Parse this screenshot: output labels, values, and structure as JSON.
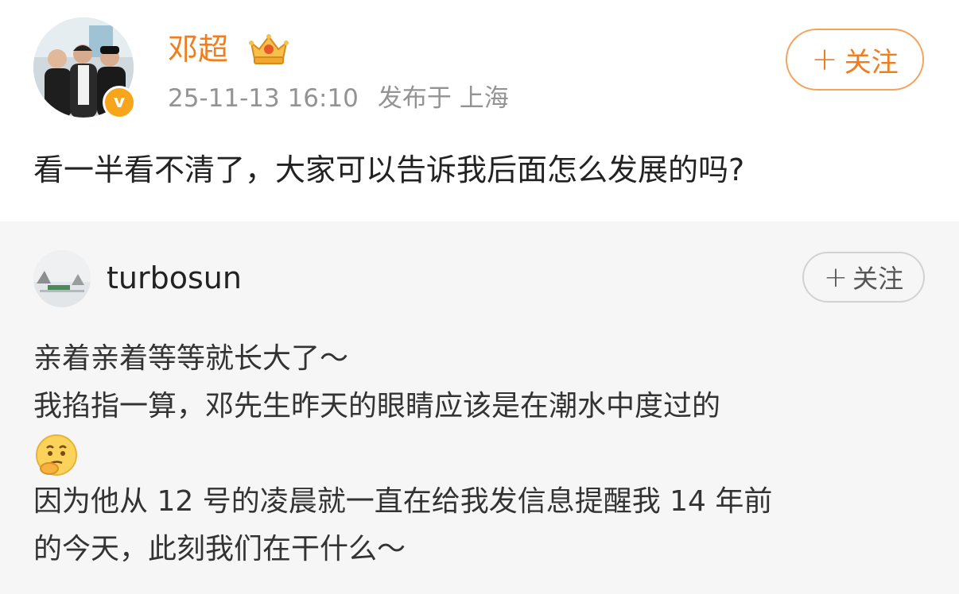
{
  "post": {
    "author": "邓超",
    "timestamp": "25-11-13 16:10",
    "location": "发布于 上海",
    "follow_label": "关注",
    "text": "看一半看不清了，大家可以告诉我后面怎么发展的吗?",
    "verified_badge": "v"
  },
  "quote": {
    "author": "turbosun",
    "follow_label": "关注",
    "lines": [
      "亲着亲着等等就长大了～",
      "我掐指一算，邓先生昨天的眼睛应该是在潮水中度过的",
      "因为他从 12 号的凌晨就一直在给我发信息提醒我 14 年前",
      "的今天，此刻我们在干什么～"
    ],
    "emoji": "thinking-face"
  },
  "colors": {
    "accent": "#f07d1e",
    "badge": "#f7a51a",
    "quote_bg": "#f6f6f6",
    "meta": "#939393"
  }
}
